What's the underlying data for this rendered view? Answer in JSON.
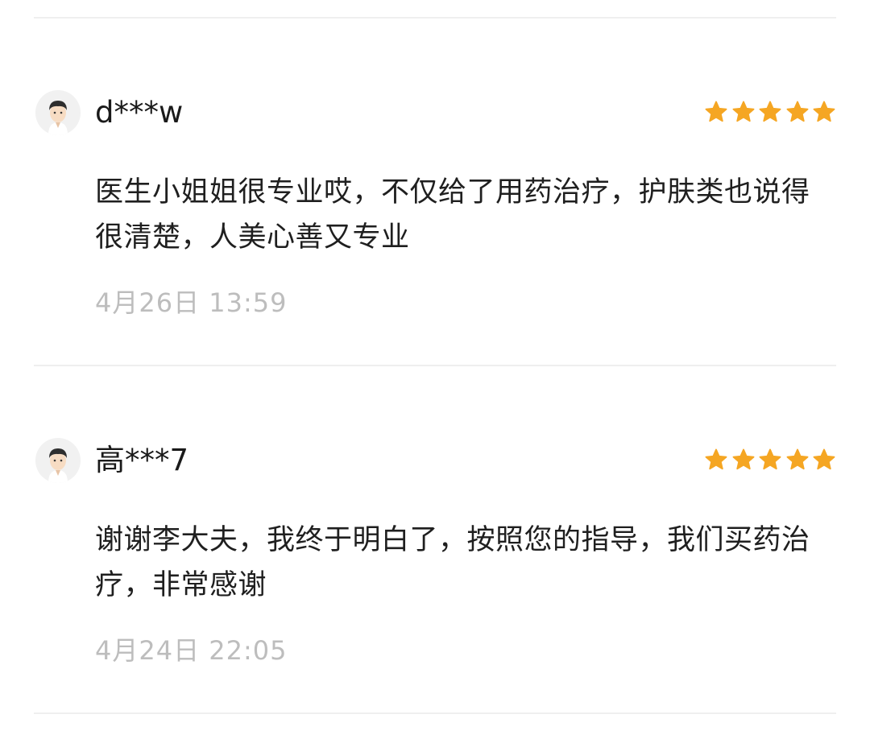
{
  "reviews": [
    {
      "username": "d***w",
      "rating": 5,
      "content": "医生小姐姐很专业哎，不仅给了用药治疗，护肤类也说得很清楚，人美心善又专业",
      "time": "4月26日 13:59",
      "avatar_icon": "user-avatar-icon"
    },
    {
      "username": "高***7",
      "rating": 5,
      "content": "谢谢李大夫，我终于明白了，按照您的指导，我们买药治疗，非常感谢",
      "time": "4月24日 22:05",
      "avatar_icon": "user-avatar-icon"
    }
  ],
  "colors": {
    "star": "#f5a623",
    "time": "#bdbdbd",
    "divider": "#efefef"
  }
}
